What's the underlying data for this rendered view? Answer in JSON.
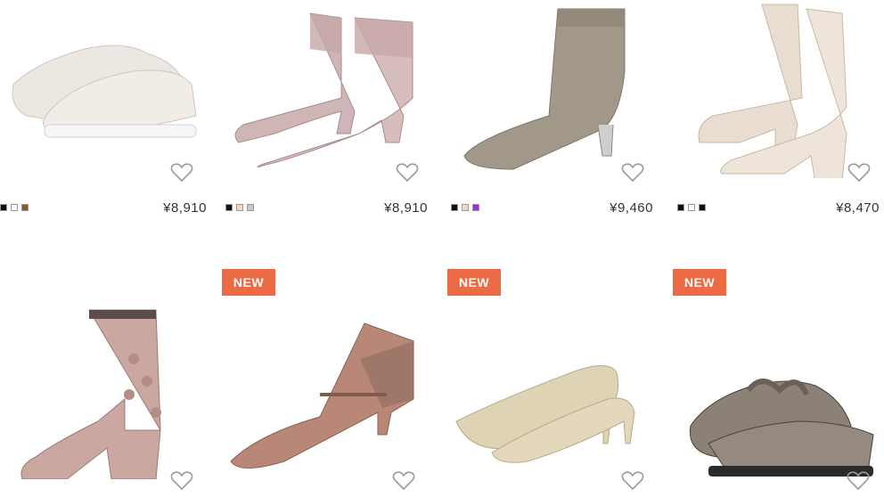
{
  "products": [
    {
      "name": "slip-on-sneaker",
      "price": "¥8,910",
      "swatches": [
        "#111111",
        "#ffffff",
        "#8a5a2b"
      ],
      "badge": ""
    },
    {
      "name": "lace-ankle-boot",
      "price": "¥8,910",
      "swatches": [
        "#111111",
        "#efd9c4",
        "#c8c8cc"
      ],
      "badge": ""
    },
    {
      "name": "knit-sock-boot",
      "price": "¥9,460",
      "swatches": [
        "#111111",
        "#efd9c4",
        "#9b30e0"
      ],
      "badge": ""
    },
    {
      "name": "platform-boot",
      "price": "¥8,470",
      "swatches": [
        "#111111",
        "#ffffff",
        "#111111"
      ],
      "badge": ""
    },
    {
      "name": "flower-ankle-boot",
      "price": "",
      "swatches": [],
      "badge": ""
    },
    {
      "name": "mary-jane-pump",
      "price": "",
      "swatches": [],
      "badge": "NEW"
    },
    {
      "name": "glitter-pump",
      "price": "",
      "swatches": [],
      "badge": "NEW"
    },
    {
      "name": "patent-ribbon-loafer",
      "price": "",
      "swatches": [],
      "badge": "NEW"
    }
  ],
  "colors": {
    "badge": "#ec6a44",
    "heart": "#9a9a9a",
    "price_text": "#333333"
  },
  "icons": {
    "favorite": "heart-outline-icon"
  }
}
